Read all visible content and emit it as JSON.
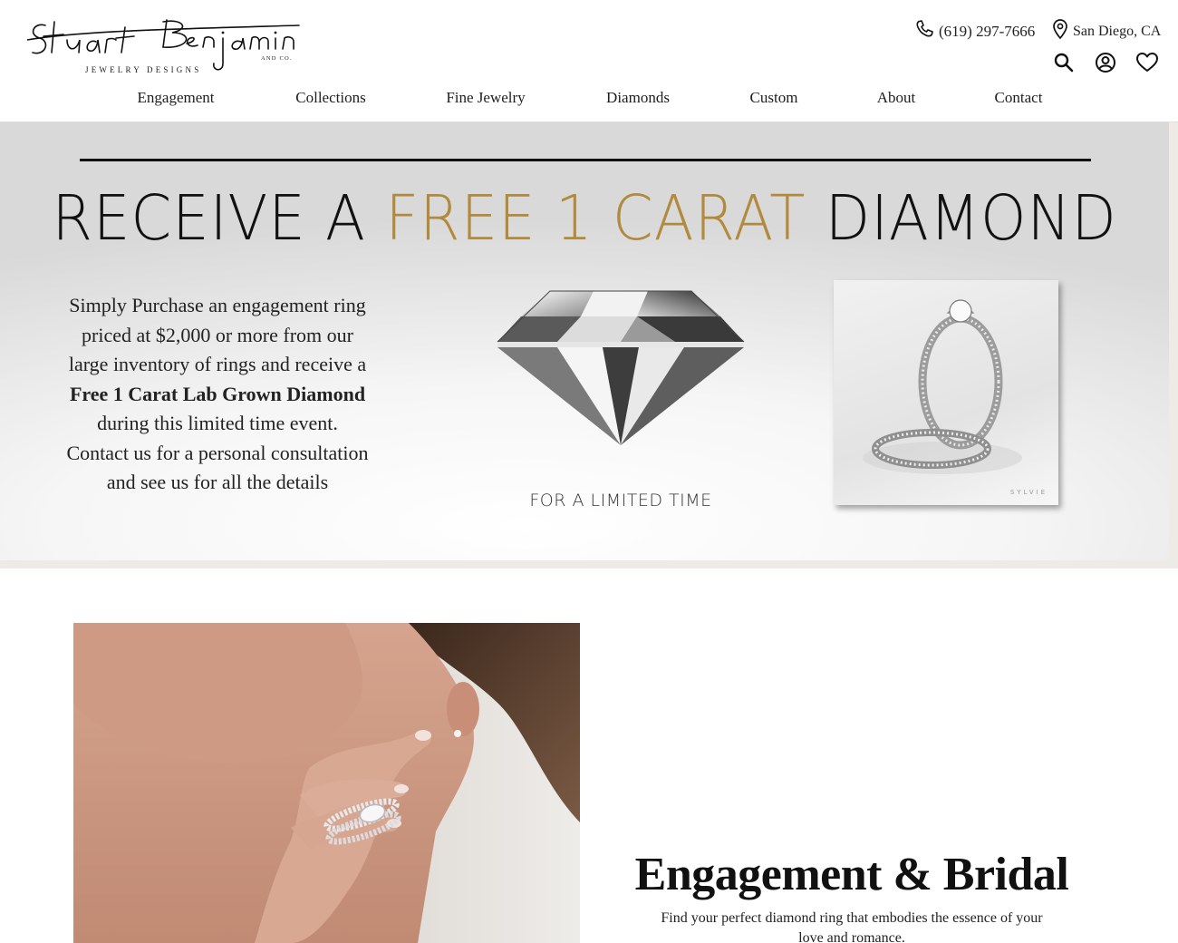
{
  "brand": {
    "name_line1": "Stuart Benjamin",
    "name_line2": "JEWELRY DESIGNS",
    "name_suffix": "AND CO."
  },
  "contact": {
    "phone": "(619) 297-7666",
    "phone_icon": "phone-icon",
    "location": "San Diego, CA",
    "location_icon": "location-pin-icon"
  },
  "tools": [
    "search-icon",
    "account-icon",
    "heart-icon"
  ],
  "nav": {
    "items": [
      "Engagement",
      "Collections",
      "Fine Jewelry",
      "Diamonds",
      "Custom",
      "About",
      "Contact"
    ]
  },
  "hero": {
    "headline_part1": "RECEIVE A ",
    "headline_highlight": "FREE 1 CARAT",
    "headline_part2": " DIAMOND",
    "copy_line1": "Simply Purchase an engagement ring",
    "copy_line2": "priced at $2,000 or more from our",
    "copy_line3": "large inventory of rings and receive a",
    "copy_bold": "Free 1 Carat Lab Grown Diamond",
    "copy_line4": "during this limited time event.",
    "copy_line5": "Contact us for a personal consultation",
    "copy_line6": "and see us for all the details",
    "limited": "FOR A LIMITED TIME",
    "photo_mark": "SYLVIE"
  },
  "section": {
    "title": "Engagement & Bridal",
    "subtitle": "Find your perfect diamond ring that embodies the essence of your love and romance."
  },
  "colors": {
    "gold": "#b18a3e",
    "text": "#1a1a1a"
  }
}
